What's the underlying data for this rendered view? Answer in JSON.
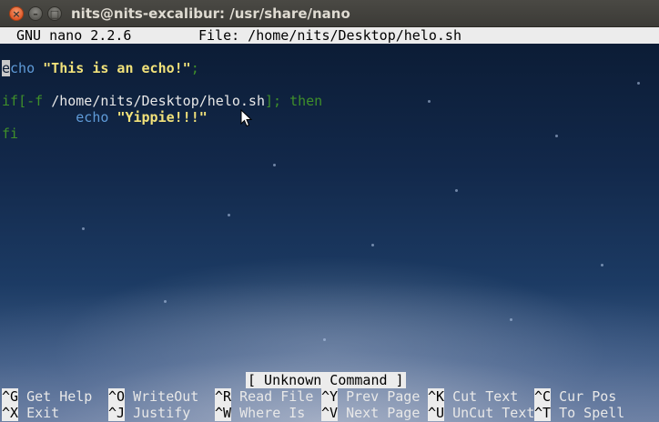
{
  "window": {
    "title": "nits@nits-excalibur: /usr/share/nano",
    "close_glyph": "×",
    "minimize_glyph": "–",
    "maximize_glyph": "□"
  },
  "nano": {
    "version": "GNU nano 2.2.6",
    "file_label": "File: /home/nits/Desktop/helo.sh",
    "status_message": "[ Unknown Command ]"
  },
  "editor": {
    "line1": {
      "cursor_char": "e",
      "keyword_rest": "cho",
      "space": " ",
      "string": "\"This is an echo!\"",
      "terminator": ";"
    },
    "line3": {
      "if_kw": "if",
      "bracket_open": "[-f ",
      "path": "/home/nits/Desktop/helo.sh",
      "bracket_close": "]; then"
    },
    "line4": {
      "indent": "         ",
      "echo_kw": "echo",
      "space": " ",
      "string": "\"Yippie!!!\""
    },
    "line5": {
      "fi_kw": "fi"
    }
  },
  "shortcuts": [
    {
      "key": "^G",
      "label": "Get Help"
    },
    {
      "key": "^O",
      "label": "WriteOut"
    },
    {
      "key": "^R",
      "label": "Read File"
    },
    {
      "key": "^Y",
      "label": "Prev Page"
    },
    {
      "key": "^K",
      "label": "Cut Text"
    },
    {
      "key": "^C",
      "label": "Cur Pos"
    },
    {
      "key": "^X",
      "label": "Exit"
    },
    {
      "key": "^J",
      "label": "Justify"
    },
    {
      "key": "^W",
      "label": "Where Is"
    },
    {
      "key": "^V",
      "label": "Next Page"
    },
    {
      "key": "^U",
      "label": "UnCut Text"
    },
    {
      "key": "^T",
      "label": "To Spell"
    }
  ],
  "colors": {
    "keyword": "#5f9bd8",
    "string": "#f2e27a",
    "conditional_green": "#3f8f2a",
    "header_bg": "#ececec",
    "close_button": "#e0592a"
  },
  "icons": [
    "close-icon",
    "minimize-icon",
    "maximize-icon",
    "mouse-pointer-icon"
  ]
}
